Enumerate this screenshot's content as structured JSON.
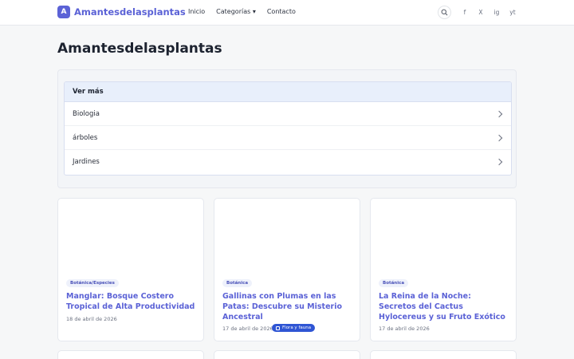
{
  "header": {
    "brand_initial": "A",
    "brand_name": "Amantesdelasplantas",
    "nav": [
      "Inicio",
      "Categorías ▾",
      "Contacto"
    ],
    "social": [
      "f",
      "X",
      "ig",
      "yt"
    ]
  },
  "page_title": "Amantesdelasplantas",
  "more": {
    "header": "Ver más",
    "items": [
      "Biologia",
      "árboles",
      "Jardines"
    ]
  },
  "cards": [
    {
      "tag": "Botánica/Especies",
      "title": "Manglar: Bosque Costero Tropical de Alta Productividad",
      "date": "18 de abril de 2026"
    },
    {
      "tag": "Botánica",
      "title": "Gallinas con Plumas en las Patas: Descubre su Misterio Ancestral",
      "date": "17 de abril de 2026",
      "badge": "Flora y fauna"
    },
    {
      "tag": "Botánica",
      "title": "La Reina de la Noche: Secretos del Cactus Hylocereus y su Fruto Exótico",
      "date": "17 de abril de 2026"
    }
  ],
  "colors": {
    "accent": "#5b62d6",
    "badge_blue": "#2f55d4"
  }
}
